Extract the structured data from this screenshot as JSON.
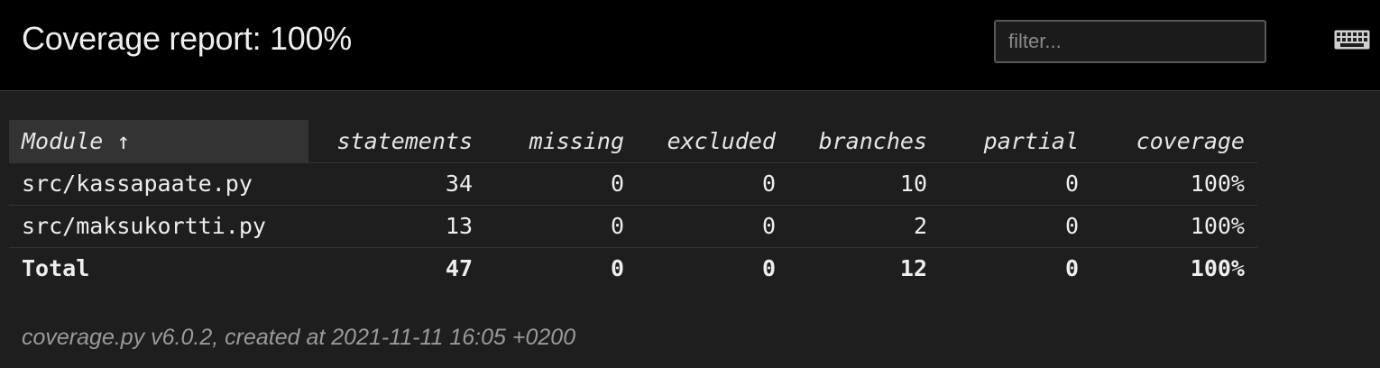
{
  "header": {
    "title": "Coverage report: 100%",
    "filter_placeholder": "filter...",
    "keyboard_icon": "keyboard-icon"
  },
  "table": {
    "columns": {
      "module": "Module ↑",
      "statements": "statements",
      "missing": "missing",
      "excluded": "excluded",
      "branches": "branches",
      "partial": "partial",
      "coverage": "coverage"
    },
    "rows": [
      {
        "module": "src/kassapaate.py",
        "statements": "34",
        "missing": "0",
        "excluded": "0",
        "branches": "10",
        "partial": "0",
        "coverage": "100%"
      },
      {
        "module": "src/maksukortti.py",
        "statements": "13",
        "missing": "0",
        "excluded": "0",
        "branches": "2",
        "partial": "0",
        "coverage": "100%"
      }
    ],
    "total": {
      "module": "Total",
      "statements": "47",
      "missing": "0",
      "excluded": "0",
      "branches": "12",
      "partial": "0",
      "coverage": "100%"
    }
  },
  "footer": {
    "text": "coverage.py v6.0.2, created at 2021-11-11 16:05 +0200"
  },
  "colors": {
    "header_bg": "#000000",
    "page_bg": "#1e1e1e",
    "text": "#eeeeee",
    "muted": "#9a9a9a"
  }
}
